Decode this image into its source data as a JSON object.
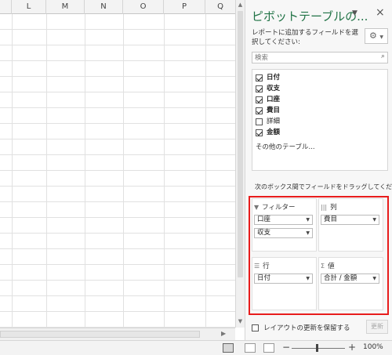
{
  "sheet": {
    "columns": [
      "L",
      "M",
      "N",
      "O",
      "P",
      "Q"
    ]
  },
  "pivot_pane": {
    "title": "ピボットテーブルの...",
    "description": "レポートに追加するフィールドを選択してください:",
    "search_placeholder": "検索",
    "fields": [
      {
        "label": "日付",
        "checked": true
      },
      {
        "label": "収支",
        "checked": true
      },
      {
        "label": "口座",
        "checked": true
      },
      {
        "label": "費目",
        "checked": true
      },
      {
        "label": "詳細",
        "checked": false
      },
      {
        "label": "金額",
        "checked": true
      }
    ],
    "more_tables": "その他のテーブル...",
    "drag_hint": "次のボックス間でフィールドをドラッグしてください:",
    "areas": {
      "filters": {
        "label": "フィルター",
        "items": [
          "口座",
          "収支"
        ]
      },
      "columns": {
        "label": "列",
        "items": [
          "費目"
        ]
      },
      "rows": {
        "label": "行",
        "items": [
          "日付"
        ]
      },
      "values": {
        "label": "値",
        "items": [
          "合計 / 金額"
        ]
      }
    },
    "defer_label": "レイアウトの更新を保留する",
    "update_button": "更新"
  },
  "statusbar": {
    "zoom": "100%"
  },
  "colors": {
    "title_green": "#217346",
    "highlight_red": "#e81c1c"
  }
}
